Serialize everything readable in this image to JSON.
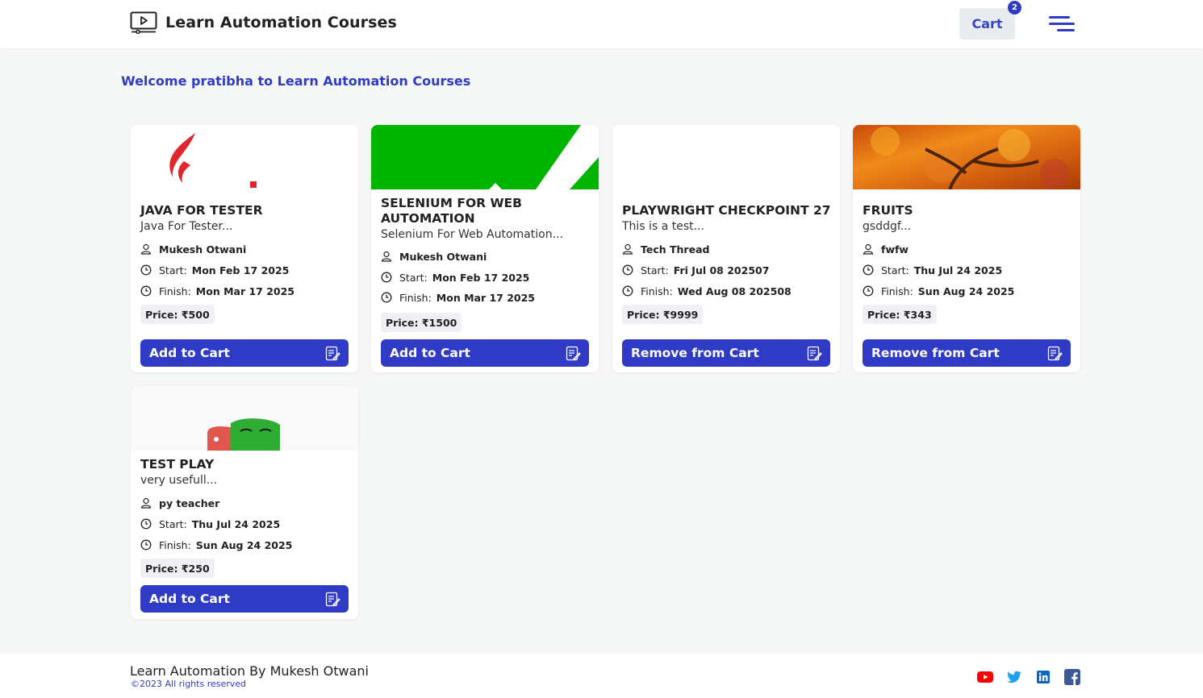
{
  "header": {
    "title": "Learn Automation Courses",
    "cart_label": "Cart",
    "cart_count": "2"
  },
  "welcome": "Welcome pratibha to Learn Automation Courses",
  "labels": {
    "start": "Start:",
    "finish": "Finish:"
  },
  "courses": [
    {
      "title": "JAVA FOR TESTER",
      "desc": "Java For Tester...",
      "instructor": "Mukesh Otwani",
      "start": "Mon Feb 17 2025",
      "finish": "Mon Mar 17 2025",
      "price": "Price: ₹500",
      "button": "Add to Cart",
      "image": "java-logo"
    },
    {
      "title": "SELENIUM FOR WEB AUTOMATION",
      "desc": "Selenium For Web Automation...",
      "instructor": "Mukesh Otwani",
      "start": "Mon Feb 17 2025",
      "finish": "Mon Mar 17 2025",
      "price": "Price: ₹1500",
      "button": "Add to Cart",
      "image": "selenium-logo"
    },
    {
      "title": "PLAYWRIGHT CHECKPOINT 27",
      "desc": "This is a test...",
      "instructor": "Tech Thread",
      "start": "Fri Jul 08 202507",
      "finish": "Wed Aug 08 202508",
      "price": "Price: ₹9999",
      "button": "Remove from Cart",
      "image": "blank"
    },
    {
      "title": "FRUITS",
      "desc": "gsddgf...",
      "instructor": "fwfw",
      "start": "Thu Jul 24 2025",
      "finish": "Sun Aug 24 2025",
      "price": "Price: ₹343",
      "button": "Remove from Cart",
      "image": "autumn-tree-photo"
    },
    {
      "title": "TEST PLAY",
      "desc": "very usefull...",
      "instructor": "py teacher",
      "start": "Thu Jul 24 2025",
      "finish": "Sun Aug 24 2025",
      "price": "Price: ₹250",
      "button": "Add to Cart",
      "image": "playwright-masks-logo"
    }
  ],
  "footer": {
    "title": "Learn Automation By Mukesh Otwani",
    "copyright": "©2023 All rights reserved",
    "social": [
      "youtube-icon",
      "twitter-icon",
      "linkedin-icon",
      "facebook-icon"
    ]
  },
  "colors": {
    "primary": "#2f3bc4",
    "background": "#f6f7f7",
    "youtube": "#ff0000",
    "twitter": "#1da1f2",
    "linkedin": "#0a66c2",
    "facebook": "#1877f2"
  }
}
